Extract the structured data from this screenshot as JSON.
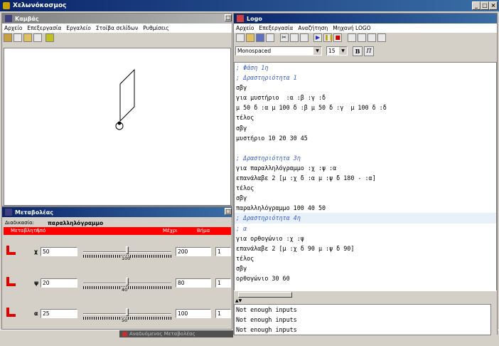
{
  "app": {
    "title": "Χελωνόκοσμος"
  },
  "canvas_window": {
    "title": "Καμβάς",
    "menu": [
      "Αρχείο",
      "Επεξεργασία",
      "Εργαλείο",
      "Στοίβα σελίδων",
      "Ρυθμίσεις"
    ]
  },
  "vars_window": {
    "title": "Μεταβολέας",
    "procedure_label": "Διαδικασία:",
    "procedure_name": "παραλληλόγραμμο",
    "headers": {
      "variable": "Μεταβλητή",
      "from": "Από",
      "to": "Μέχρι",
      "step": "Βήμα"
    },
    "rows": [
      {
        "name": "χ",
        "value": "50",
        "slider": 100,
        "max": "200",
        "step": "1"
      },
      {
        "name": "ψ",
        "value": "20",
        "slider": 40,
        "max": "80",
        "step": "1"
      },
      {
        "name": "α",
        "value": "25",
        "slider": 50,
        "max": "100",
        "step": "1"
      }
    ]
  },
  "logo_window": {
    "title": "Logo",
    "menu": [
      "Αρχείο",
      "Επεξεργασία",
      "Αναζήτηση",
      "Μηχανή LOGO"
    ],
    "font_name": "Monospaced",
    "font_size": "15",
    "bold_label": "B",
    "italic_label": "Π",
    "code_lines": [
      {
        "text": "; Φάση 1η",
        "type": "comment"
      },
      {
        "text": "; Δραστηριότητα 1",
        "type": "comment"
      },
      {
        "text": "σβγ",
        "type": "code"
      },
      {
        "text": "για μυστήριο  :α :β :γ :δ",
        "type": "code"
      },
      {
        "text": "μ 50 δ :α μ 100 δ :β μ 50 δ :γ  μ 100 δ :δ",
        "type": "code"
      },
      {
        "text": "τέλος",
        "type": "code"
      },
      {
        "text": "σβγ",
        "type": "code"
      },
      {
        "text": "μυστήριο 10 20 30 45",
        "type": "code"
      },
      {
        "text": "",
        "type": "code"
      },
      {
        "text": "; Δραστηριότητα 3η",
        "type": "comment"
      },
      {
        "text": "για παραλληλόγραμμο :χ :ψ :α",
        "type": "code"
      },
      {
        "text": "επανάλαβε 2 [μ :χ δ :α μ :ψ δ 180 - :α]",
        "type": "code"
      },
      {
        "text": "τέλος",
        "type": "code"
      },
      {
        "text": "σβγ",
        "type": "code"
      },
      {
        "text": "παραλληλόγραμμο 100 40 50",
        "type": "code"
      },
      {
        "text": "; Δραστηριότητα 4η",
        "type": "comment-hl"
      },
      {
        "text": "; α",
        "type": "comment"
      },
      {
        "text": "για ορθογώνιο :χ :ψ",
        "type": "code"
      },
      {
        "text": "επανάλαβε 2 [μ :χ δ 90 μ :ψ δ 90]",
        "type": "code"
      },
      {
        "text": "τέλος",
        "type": "code"
      },
      {
        "text": "σβγ",
        "type": "code"
      },
      {
        "text": "ορθογώνιο 30 60",
        "type": "code"
      }
    ],
    "output_lines": [
      "Not enough inputs",
      "Not enough inputs",
      "Not enough inputs"
    ]
  },
  "taskbar": {
    "item_label": "Αναδυόμενος Μεταβολέας"
  }
}
